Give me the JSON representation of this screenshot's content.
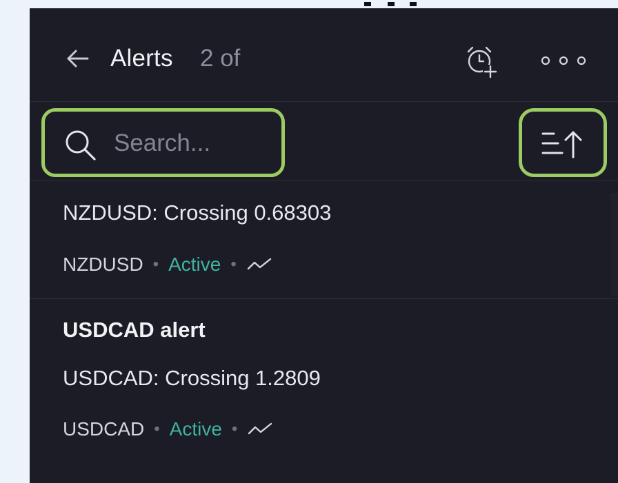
{
  "header": {
    "title": "Alerts",
    "count_text": "2 of",
    "icons": {
      "back": "back-arrow-icon",
      "add_alert": "alarm-clock-plus-icon",
      "more": "more-horizontal-icon"
    }
  },
  "toolbar": {
    "search_placeholder": "Search...",
    "search_value": "",
    "sort_icon": "sort-ascending-icon"
  },
  "alerts": [
    {
      "name": "",
      "condition": "NZDUSD: Crossing 0.68303",
      "symbol": "NZDUSD",
      "status": "Active",
      "type_icon": "price-line-icon"
    },
    {
      "name": "USDCAD alert",
      "condition": "USDCAD: Crossing 1.2809",
      "symbol": "USDCAD",
      "status": "Active",
      "type_icon": "price-line-icon"
    }
  ],
  "colors": {
    "panel_bg": "#1b1c25",
    "page_bg": "#edf3fb",
    "highlight": "#9bcb62",
    "active_status": "#3fb39f",
    "primary_text": "#f1f2f5",
    "muted_text": "#8d909a"
  }
}
